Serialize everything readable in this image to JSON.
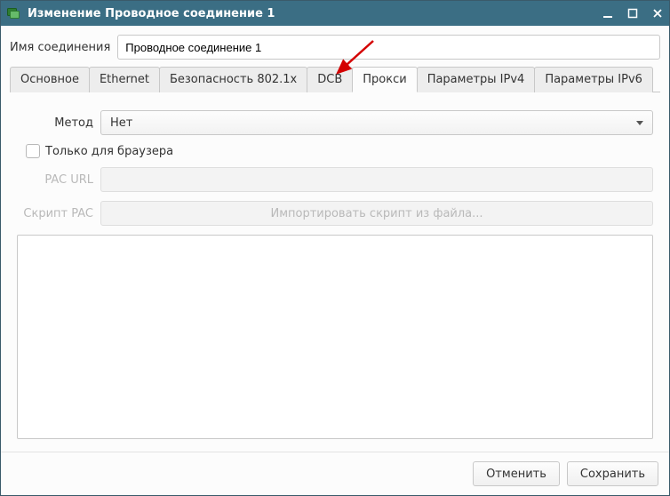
{
  "window": {
    "title": "Изменение Проводное соединение 1"
  },
  "name_row": {
    "label": "Имя соединения",
    "value": "Проводное соединение 1"
  },
  "tabs": [
    {
      "label": "Основное"
    },
    {
      "label": "Ethernet"
    },
    {
      "label": "Безопасность 802.1x"
    },
    {
      "label": "DCB"
    },
    {
      "label": "Прокси"
    },
    {
      "label": "Параметры IPv4"
    },
    {
      "label": "Параметры IPv6"
    }
  ],
  "proxy": {
    "method_label": "Метод",
    "method_value": "Нет",
    "browser_only_label": "Только для браузера",
    "pac_url_label": "PAC URL",
    "pac_script_label": "Скрипт PAC",
    "import_button": "Импортировать скрипт из файла..."
  },
  "footer": {
    "cancel": "Отменить",
    "save": "Сохранить"
  }
}
